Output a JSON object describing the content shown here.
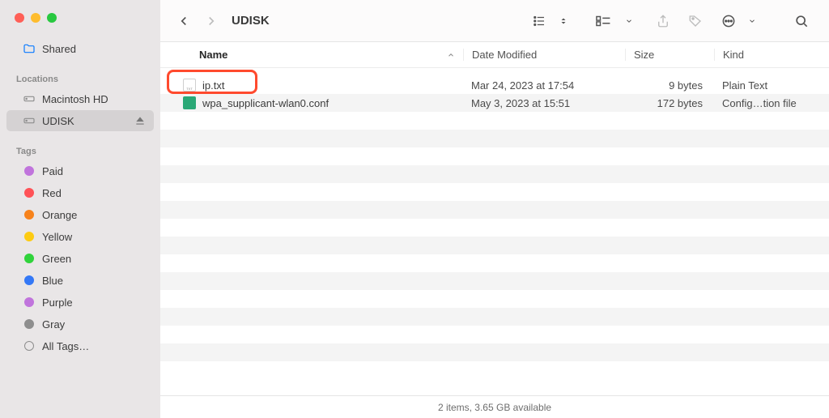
{
  "window": {
    "title": "UDISK"
  },
  "sidebar": {
    "shared_label": "Shared",
    "locations_heading": "Locations",
    "locations": [
      {
        "label": "Macintosh HD"
      },
      {
        "label": "UDISK"
      }
    ],
    "tags_heading": "Tags",
    "tags": [
      {
        "label": "Paid",
        "class": "tag-purple"
      },
      {
        "label": "Red",
        "class": "tag-red"
      },
      {
        "label": "Orange",
        "class": "tag-orange"
      },
      {
        "label": "Yellow",
        "class": "tag-yellow"
      },
      {
        "label": "Green",
        "class": "tag-green"
      },
      {
        "label": "Blue",
        "class": "tag-blue"
      },
      {
        "label": "Purple",
        "class": "tag-purple2"
      },
      {
        "label": "Gray",
        "class": "tag-gray"
      }
    ],
    "all_tags_label": "All Tags…"
  },
  "columns": {
    "name": "Name",
    "date": "Date Modified",
    "size": "Size",
    "kind": "Kind"
  },
  "files": [
    {
      "name": "ip.txt",
      "date": "Mar 24, 2023 at 17:54",
      "size": "9 bytes",
      "kind": "Plain Text",
      "icon": "txt"
    },
    {
      "name": "wpa_supplicant-wlan0.conf",
      "date": "May 3, 2023 at 15:51",
      "size": "172 bytes",
      "kind": "Config…tion file",
      "icon": "conf"
    }
  ],
  "status": "2 items, 3.65 GB available"
}
